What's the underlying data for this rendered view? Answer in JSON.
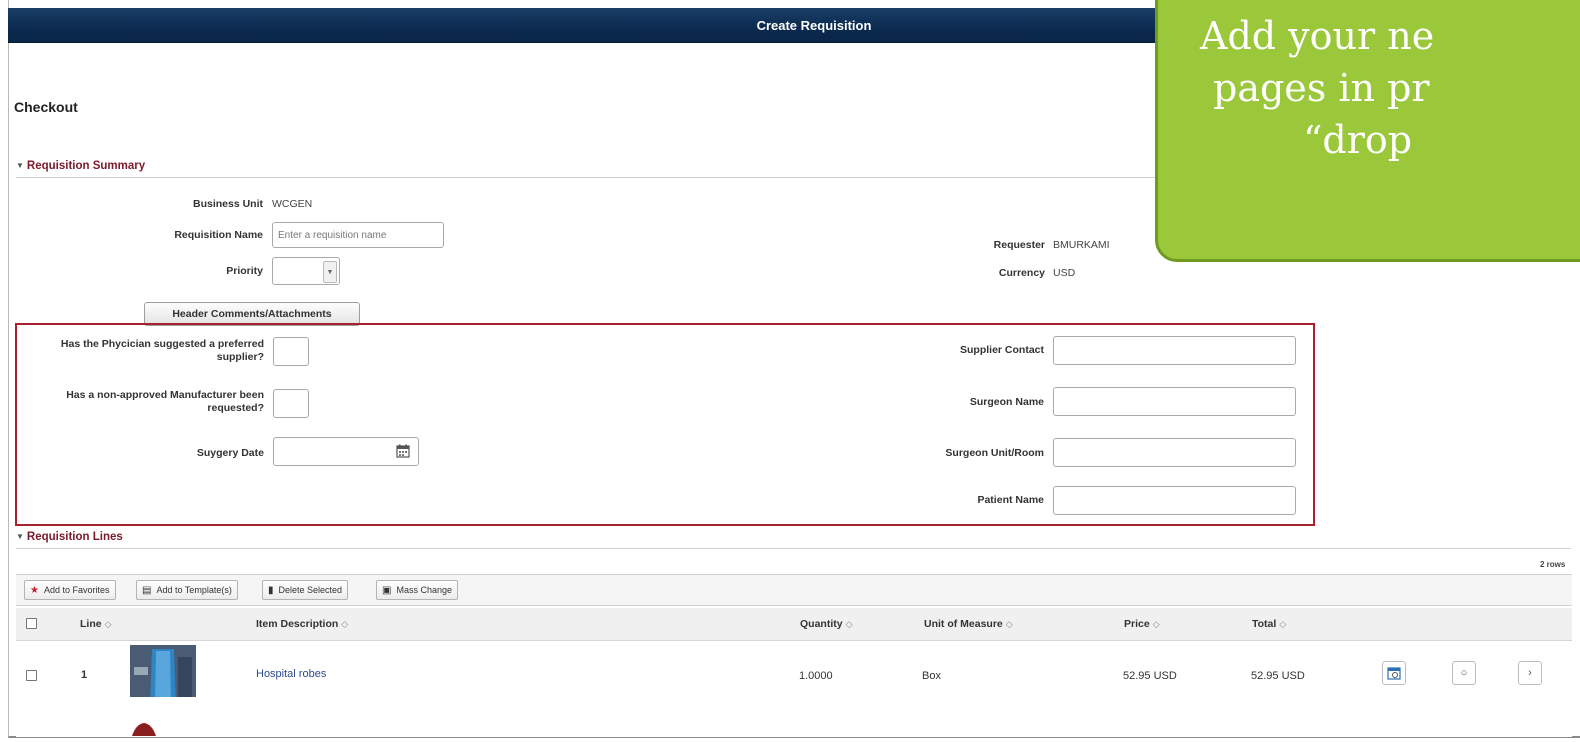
{
  "window": {
    "title": "Create Requisition"
  },
  "page": {
    "heading": "Checkout"
  },
  "summary": {
    "section_title": "Requisition Summary",
    "business_unit_label": "Business Unit",
    "business_unit_value": "WCGEN",
    "requisition_name_label": "Requisition Name",
    "requisition_name_placeholder": "Enter a requisition name",
    "requisition_name_value": "",
    "priority_label": "Priority",
    "priority_value": "",
    "requester_label": "Requester",
    "requester_value": "BMURKAMI",
    "currency_label": "Currency",
    "currency_value": "USD",
    "header_comments_button": "Header Comments/Attachments"
  },
  "custom_fields": {
    "physician_label": "Has the Phycician suggested a preferred supplier?",
    "manufacturer_label": "Has a non-approved Manufacturer been requested?",
    "surgery_date_label": "Suygery Date",
    "supplier_contact_label": "Supplier Contact",
    "surgeon_name_label": "Surgeon Name",
    "surgeon_unit_label": "Surgeon Unit/Room",
    "patient_name_label": "Patient Name",
    "highlight_color": "#a8202e"
  },
  "lines": {
    "section_title": "Requisition Lines",
    "row_count_text": "2 rows",
    "toolbar": {
      "add_favorites": "Add to Favorites",
      "add_templates": "Add to Template(s)",
      "delete_selected": "Delete Selected",
      "mass_change": "Mass Change"
    },
    "columns": {
      "line": "Line",
      "item_description": "Item Description",
      "quantity": "Quantity",
      "uom": "Unit of Measure",
      "price": "Price",
      "total": "Total"
    },
    "sort_glyph": "◇",
    "rows": [
      {
        "line": "1",
        "item_description": "Hospital robes",
        "quantity": "1.0000",
        "uom": "Box",
        "price": "52.95 USD",
        "total": "52.95 USD"
      }
    ]
  },
  "callout": {
    "line1": "Add your ne",
    "line2": "pages in pr",
    "line3": "“drop",
    "color": "#9ac83a"
  },
  "icons": [
    "star-icon",
    "template-icon",
    "trash-icon",
    "mass-change-icon",
    "calendar-icon",
    "schedule-icon",
    "comment-icon",
    "chevron-right-icon",
    "dropdown-arrow-icon",
    "collapse-triangle-icon"
  ]
}
